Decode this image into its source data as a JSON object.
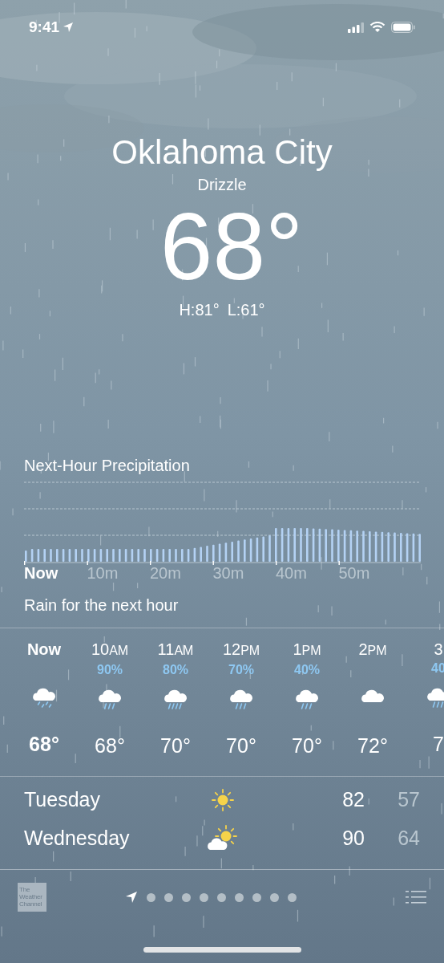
{
  "status_bar": {
    "time": "9:41"
  },
  "current": {
    "city": "Oklahoma City",
    "condition": "Drizzle",
    "temperature": "68°",
    "high": "H:81°",
    "low": "L:61°"
  },
  "precipitation": {
    "title": "Next-Hour Precipitation",
    "labels": [
      {
        "text": "Now",
        "selected": true
      },
      {
        "text": "10m",
        "selected": false
      },
      {
        "text": "20m",
        "selected": false
      },
      {
        "text": "30m",
        "selected": false
      },
      {
        "text": "40m",
        "selected": false
      },
      {
        "text": "50m",
        "selected": false
      }
    ],
    "summary": "Rain for the next hour"
  },
  "hourly": [
    {
      "time": "Now",
      "selected": true,
      "kind": "drizzle",
      "temp": "68°"
    },
    {
      "time": "10",
      "period": "AM",
      "selected": false,
      "chance": "90%",
      "kind": "rain",
      "temp": "68°"
    },
    {
      "time": "11",
      "period": "AM",
      "selected": false,
      "chance": "80%",
      "kind": "heavy-rain",
      "temp": "70°"
    },
    {
      "time": "12",
      "period": "PM",
      "selected": false,
      "chance": "70%",
      "kind": "rain",
      "temp": "70°"
    },
    {
      "time": "1",
      "period": "PM",
      "selected": false,
      "chance": "40%",
      "kind": "rain",
      "temp": "70°"
    },
    {
      "time": "2",
      "period": "PM",
      "selected": false,
      "kind": "cloud",
      "temp": "72°"
    },
    {
      "time": "3",
      "selected": false,
      "chance": "40",
      "kind": "rain",
      "temp": "7"
    }
  ],
  "daily": [
    {
      "day": "Tuesday",
      "kind": "sun",
      "high": "82",
      "low": "57"
    },
    {
      "day": "Wednesday",
      "kind": "partly-cloudy",
      "high": "90",
      "low": "64"
    }
  ],
  "footer": {
    "logo": "The Weather Channel",
    "pages": [
      {
        "kind": "location",
        "selected": true
      },
      {
        "kind": "dot",
        "selected": false
      },
      {
        "kind": "dot",
        "selected": false
      },
      {
        "kind": "dot",
        "selected": false
      },
      {
        "kind": "dot",
        "selected": false
      },
      {
        "kind": "dot",
        "selected": false
      },
      {
        "kind": "dot",
        "selected": false
      },
      {
        "kind": "dot",
        "selected": false
      },
      {
        "kind": "dot",
        "selected": false
      },
      {
        "kind": "dot",
        "selected": false
      }
    ]
  }
}
